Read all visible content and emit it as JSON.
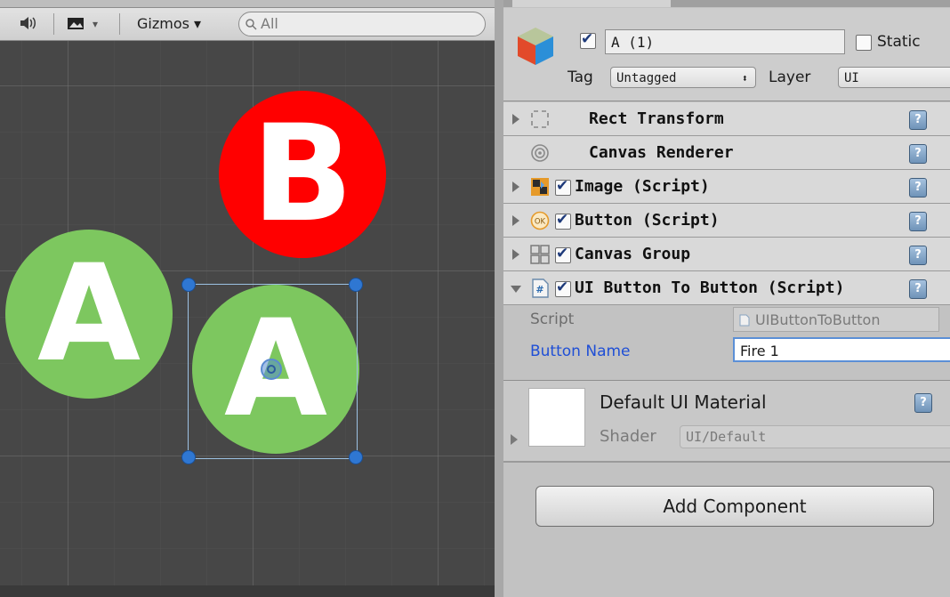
{
  "scene": {
    "toolbar": {
      "audio_icon": "speaker-icon",
      "image_icon": "image-icon",
      "gizmos_label": "Gizmos ▾",
      "search_placeholder": "All"
    },
    "objects": [
      {
        "letter": "B",
        "color": "#ff0000"
      },
      {
        "letter": "A",
        "color": "#7dc75f"
      },
      {
        "letter": "A",
        "color": "#7dc75f"
      }
    ]
  },
  "inspector": {
    "object_name": "A (1)",
    "active": true,
    "static_label": "Static",
    "static_checked": false,
    "tag_label": "Tag",
    "tag_value": "Untagged",
    "layer_label": "Layer",
    "layer_value": "UI",
    "components": [
      {
        "title": "Rect Transform",
        "icon": "rect-transform-icon",
        "has_check": false
      },
      {
        "title": "Canvas Renderer",
        "icon": "canvas-renderer-icon",
        "has_check": false
      },
      {
        "title": "Image (Script)",
        "icon": "image-component-icon",
        "has_check": true
      },
      {
        "title": "Button (Script)",
        "icon": "button-component-icon",
        "has_check": true
      },
      {
        "title": "Canvas Group",
        "icon": "canvas-group-icon",
        "has_check": true
      },
      {
        "title": "UI Button To Button (Script)",
        "icon": "csharp-script-icon",
        "has_check": true
      }
    ],
    "script_label": "Script",
    "script_value": "UIButtonToButton",
    "button_name_label": "Button Name",
    "button_name_value": "Fire 1",
    "material_name": "Default UI Material",
    "shader_label": "Shader",
    "shader_value": "UI/Default",
    "add_component_label": "Add Component",
    "help_glyph": "?"
  }
}
